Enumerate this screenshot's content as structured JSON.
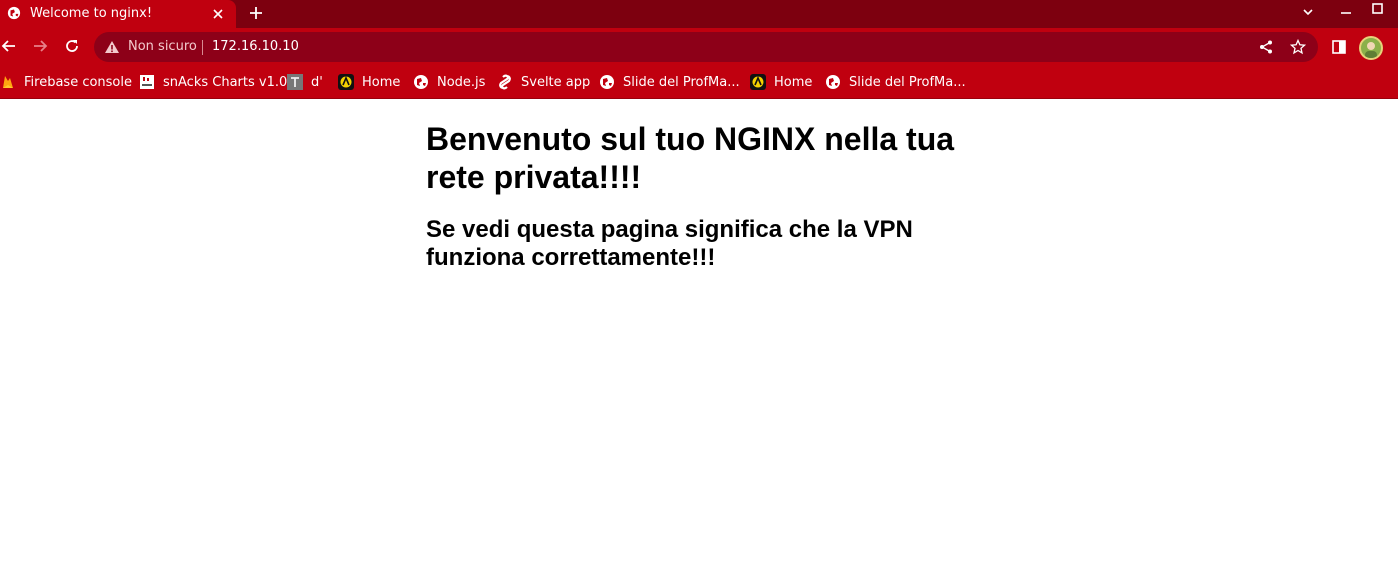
{
  "browser": {
    "tab": {
      "title": "Welcome to nginx!",
      "favicon": "globe-icon"
    },
    "security_label": "Non sicuro",
    "url": "172.16.10.10",
    "colors": {
      "frame": "#7d000f",
      "toolbar": "#c0000f",
      "omnibox": "#8d0018",
      "text": "#ffffff"
    }
  },
  "bookmarks": [
    {
      "label": "Firebase console",
      "icon": "firebase-icon"
    },
    {
      "label": "snAcks Charts v1.0",
      "icon": "snacks-icon"
    },
    {
      "label": "d'",
      "icon": "typewriter-icon"
    },
    {
      "label": "Home",
      "icon": "home-site-icon"
    },
    {
      "label": "Node.js",
      "icon": "globe-icon"
    },
    {
      "label": "Svelte app",
      "icon": "svelte-icon"
    },
    {
      "label": "Slide del ProfMa...",
      "icon": "globe-icon"
    },
    {
      "label": "Home",
      "icon": "home-site-icon"
    },
    {
      "label": "Slide del ProfMa...",
      "icon": "globe-icon"
    }
  ],
  "page": {
    "heading": "Benvenuto sul tuo NGINX nella tua rete privata!!!!",
    "subheading": "Se vedi questa pagina significa che la VPN funziona correttamente!!!"
  }
}
